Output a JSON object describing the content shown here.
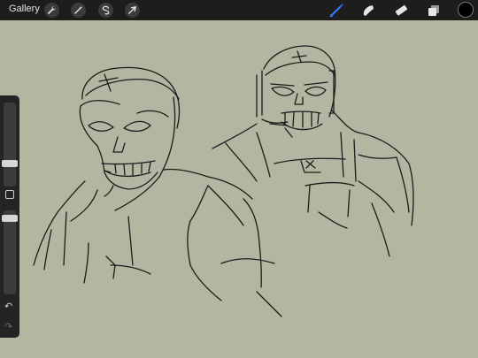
{
  "topbar": {
    "gallery_label": "Gallery",
    "left_tools": [
      {
        "name": "wrench-icon"
      },
      {
        "name": "magic-wand-icon"
      },
      {
        "name": "selection-icon"
      },
      {
        "name": "transform-arrow-icon"
      }
    ],
    "right_tools": [
      {
        "name": "brush-icon",
        "active": true
      },
      {
        "name": "smudge-icon"
      },
      {
        "name": "eraser-icon"
      },
      {
        "name": "layers-icon"
      }
    ],
    "current_color": "#000000",
    "accent_color": "#2f7cf6"
  },
  "canvas": {
    "background": "#b3b6a0",
    "stroke_color": "#1c1c1c"
  },
  "sidebar": {
    "brush_size_level": 0.74,
    "opacity_level": 0.0,
    "undo_icon": "undo-icon",
    "redo_icon": "redo-icon"
  }
}
